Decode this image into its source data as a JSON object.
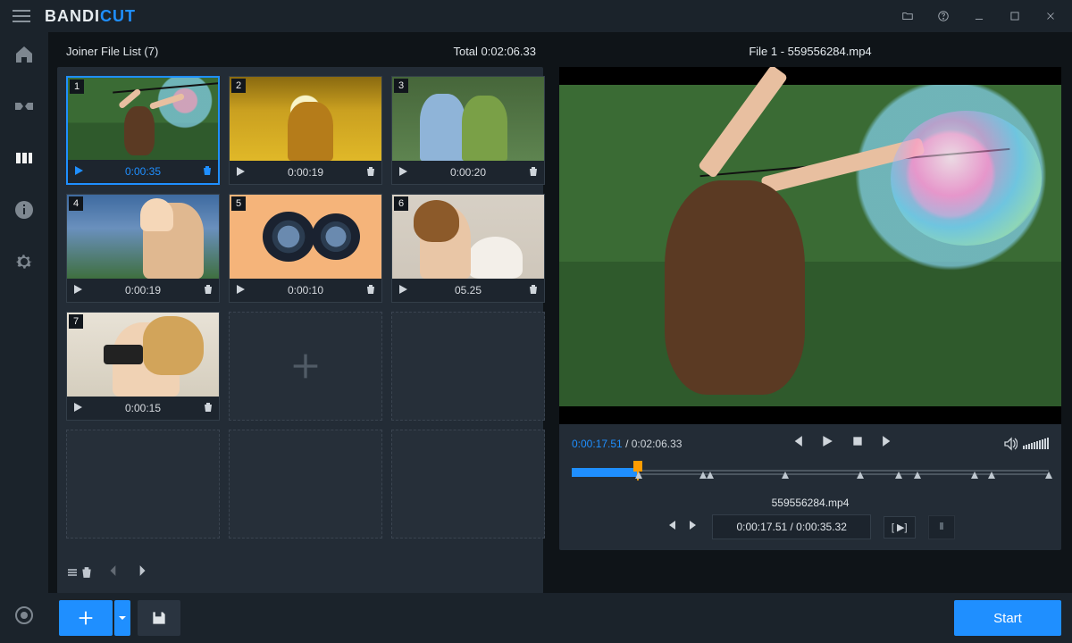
{
  "brand": {
    "part1": "BANDI",
    "part2": "CUT"
  },
  "titlebar_buttons": [
    "folder",
    "help",
    "minimize",
    "maximize",
    "close"
  ],
  "sidebar": {
    "items": [
      "home",
      "cut",
      "join",
      "info",
      "settings",
      "record"
    ]
  },
  "list": {
    "title": "Joiner File List (7)",
    "total_label": "Total 0:02:06.33",
    "footer": {
      "trash": "trash-all",
      "prev": "prev",
      "next": "next"
    }
  },
  "clips": [
    {
      "num": "1",
      "duration": "0:00:35",
      "selected": true
    },
    {
      "num": "2",
      "duration": "0:00:19",
      "selected": false
    },
    {
      "num": "3",
      "duration": "0:00:20",
      "selected": false
    },
    {
      "num": "4",
      "duration": "0:00:19",
      "selected": false
    },
    {
      "num": "5",
      "duration": "0:00:10",
      "selected": false
    },
    {
      "num": "6",
      "duration": "05.25",
      "selected": false
    },
    {
      "num": "7",
      "duration": "0:00:15",
      "selected": false
    }
  ],
  "player": {
    "title": "File 1 - 559556284.mp4",
    "current": "0:00:17.51",
    "total": "0:02:06.33",
    "segment_name": "559556284.mp4",
    "segment_time": "0:00:17.51 / 0:00:35.32",
    "segment_range_btn": "[ ▶]"
  },
  "bottom": {
    "start_label": "Start"
  },
  "timeline": {
    "progress_pct": 13.8,
    "markers_pct": [
      14,
      27.6,
      29,
      44.7,
      60.5,
      68.5,
      72.5,
      84.4,
      88,
      100
    ]
  }
}
